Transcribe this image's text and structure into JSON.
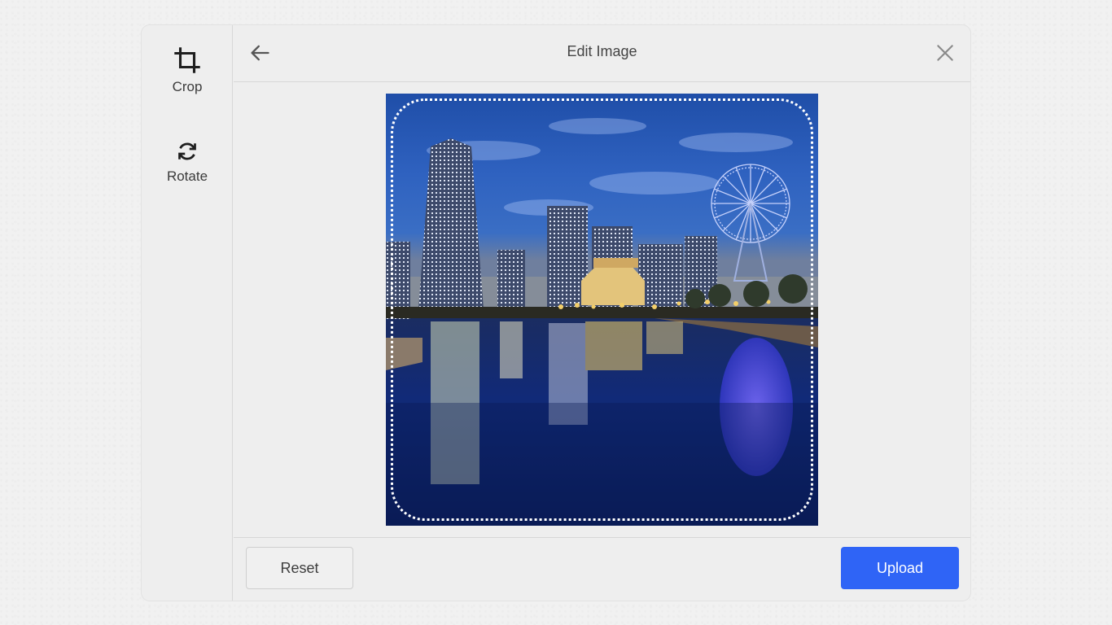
{
  "dialog": {
    "title": "Edit Image"
  },
  "sidebar": {
    "tools": [
      {
        "label": "Crop",
        "icon": "crop-icon"
      },
      {
        "label": "Rotate",
        "icon": "rotate-icon"
      }
    ]
  },
  "header": {
    "back_icon": "arrow-left-icon",
    "close_icon": "close-icon"
  },
  "image": {
    "subject": "night city skyline with ferris wheel reflected in water",
    "crop_shape": "rounded-square"
  },
  "footer": {
    "reset_label": "Reset",
    "upload_label": "Upload"
  },
  "colors": {
    "accent": "#2f64f6",
    "background": "#eeeeee"
  }
}
